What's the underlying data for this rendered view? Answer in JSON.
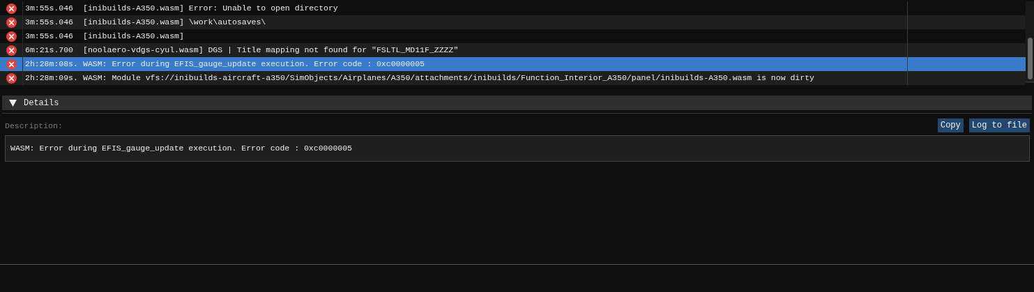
{
  "log_rows": [
    {
      "kind": "error",
      "time": "3m:55s.046",
      "message": "[inibuilds-A350.wasm] Error: Unable to open directory",
      "selected": false
    },
    {
      "kind": "error",
      "time": "3m:55s.046",
      "message": "[inibuilds-A350.wasm] \\work\\autosaves\\",
      "selected": false
    },
    {
      "kind": "error",
      "time": "3m:55s.046",
      "message": "[inibuilds-A350.wasm]",
      "selected": false
    },
    {
      "kind": "error",
      "time": "6m:21s.700",
      "message": "[noolaero-vdgs-cyul.wasm] DGS | Title mapping not found for \"FSLTL_MD11F_ZZZZ\"",
      "selected": false
    },
    {
      "kind": "error",
      "time": "2h:28m:08s.",
      "message": "WASM: Error during EFIS_gauge_update execution. Error code : 0xc0000005",
      "selected": true
    },
    {
      "kind": "error",
      "time": "2h:28m:09s.",
      "message": "WASM: Module vfs://inibuilds-aircraft-a350/SimObjects/Airplanes/A350/attachments/inibuilds/Function_Interior_A350/panel/inibuilds-A350.wasm is now dirty",
      "selected": false
    }
  ],
  "details": {
    "title": "Details",
    "expanded": true,
    "description_label": "Description:",
    "buttons": [
      "Copy",
      "Log to file"
    ],
    "description": "WASM: Error during EFIS_gauge_update execution. Error code : 0xc0000005"
  }
}
